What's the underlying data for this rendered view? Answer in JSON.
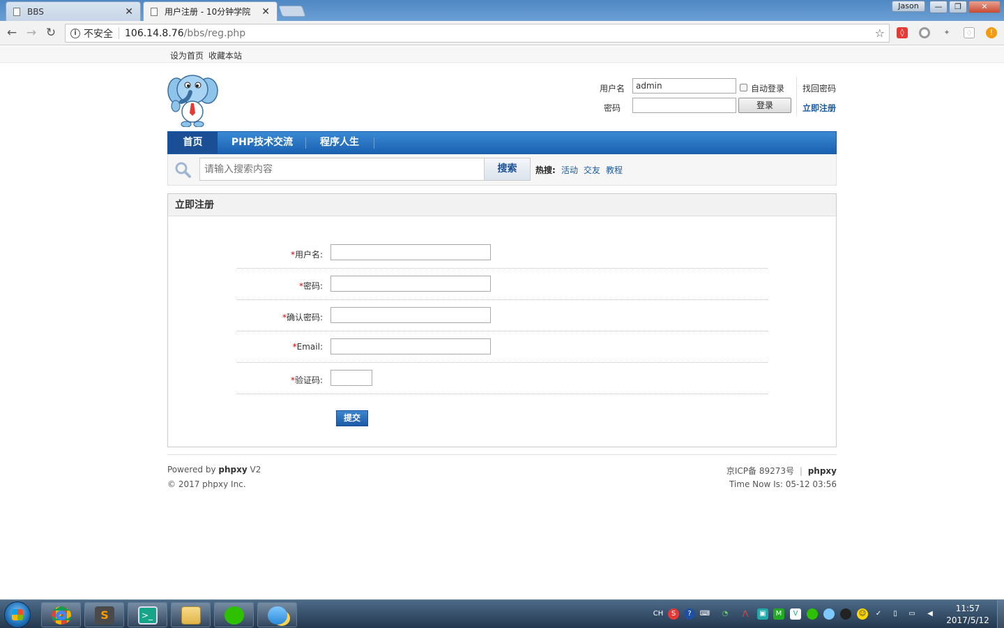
{
  "browser": {
    "tabs": [
      {
        "label": "BBS",
        "close": "✕"
      },
      {
        "label": "用户注册 - 10分钟学院",
        "close": "✕"
      }
    ],
    "user_badge": "Jason",
    "address": {
      "security_label": "不安全",
      "host": "106.14.8.76",
      "path": "/bbs/reg.php"
    }
  },
  "top_links": [
    "设为首页",
    "收藏本站"
  ],
  "login": {
    "username_label": "用户名",
    "username_value": "admin",
    "password_label": "密码",
    "auto_login_label": "自动登录",
    "login_button": "登录",
    "find_password": "找回密码",
    "register_now": "立即注册"
  },
  "main_nav": [
    "首页",
    "PHP技术交流",
    "程序人生"
  ],
  "search": {
    "placeholder": "请输入搜索内容",
    "button": "搜索",
    "hot_label": "热搜:",
    "hot_links": [
      "活动",
      "交友",
      "教程"
    ]
  },
  "register": {
    "title": "立即注册",
    "required_mark": "*",
    "fields": [
      {
        "label": "用户名:"
      },
      {
        "label": "密码:"
      },
      {
        "label": "确认密码:"
      },
      {
        "label": "Email:"
      },
      {
        "label": "验证码:"
      }
    ],
    "submit": "提交"
  },
  "footer": {
    "powered_prefix": "Powered by",
    "powered_brand": "phpxy",
    "powered_version": "V2",
    "copyright": "© 2017 phpxy Inc.",
    "icp": "京ICP备 89273号",
    "divider": "|",
    "brand": "phpxy",
    "time_now": "Time Now Is: 05-12 03:56"
  },
  "taskbar": {
    "ime": "CH",
    "time": "11:57",
    "date": "2017/5/12"
  },
  "colors": {
    "nav_blue": "#1a60b2",
    "link_blue": "#1a5a9e",
    "required_red": "#dd0000"
  }
}
